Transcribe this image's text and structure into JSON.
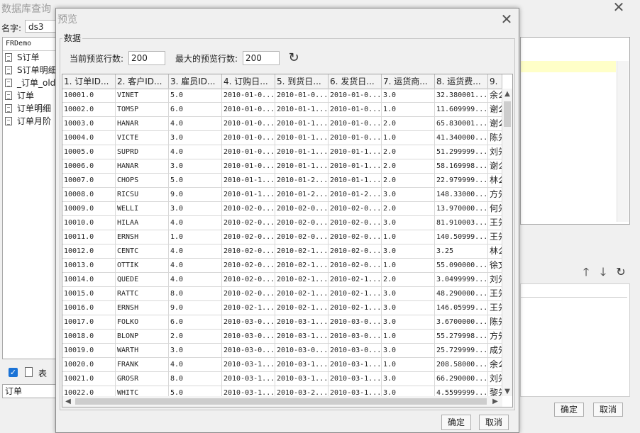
{
  "background_window": {
    "title": "数据库查询",
    "name_label": "名字:",
    "name_value": "ds3",
    "connection": "FRDemo",
    "tree_items": [
      "S订单",
      "S订单明细",
      "_订单_old",
      "订单",
      "订单明细",
      "订单月阶"
    ],
    "show_table_label": "表",
    "bottom_value": "订单",
    "ok_label": "确定",
    "cancel_label": "取消"
  },
  "dialog": {
    "title": "预览",
    "group_label": "数据",
    "current_rows_label": "当前预览行数:",
    "current_rows_value": "200",
    "max_rows_label": "最大的预览行数:",
    "max_rows_value": "200",
    "ok_label": "确定",
    "cancel_label": "取消"
  },
  "grid": {
    "columns": [
      "1. 订单ID...",
      "2. 客户ID...",
      "3. 雇员ID...",
      "4. 订购日...",
      "5. 到货日...",
      "6. 发货日...",
      "7. 运货商...",
      "8. 运货费...",
      "9."
    ],
    "rows": [
      [
        "10001.0",
        "VINET",
        "5.0",
        "2010-01-0...",
        "2010-01-0...",
        "2010-01-0...",
        "3.0",
        "32.380001...",
        "余么"
      ],
      [
        "10002.0",
        "TOMSP",
        "6.0",
        "2010-01-0...",
        "2010-01-1...",
        "2010-01-0...",
        "1.0",
        "11.609999...",
        "谢么"
      ],
      [
        "10003.0",
        "HANAR",
        "4.0",
        "2010-01-0...",
        "2010-01-1...",
        "2010-01-0...",
        "2.0",
        "65.830001...",
        "谢么"
      ],
      [
        "10004.0",
        "VICTE",
        "3.0",
        "2010-01-0...",
        "2010-01-1...",
        "2010-01-0...",
        "1.0",
        "41.340000...",
        "陈先"
      ],
      [
        "10005.0",
        "SUPRD",
        "4.0",
        "2010-01-0...",
        "2010-01-1...",
        "2010-01-1...",
        "2.0",
        "51.299999...",
        "刘先"
      ],
      [
        "10006.0",
        "HANAR",
        "3.0",
        "2010-01-0...",
        "2010-01-1...",
        "2010-01-1...",
        "2.0",
        "58.169998...",
        "谢么"
      ],
      [
        "10007.0",
        "CHOPS",
        "5.0",
        "2010-01-1...",
        "2010-01-2...",
        "2010-01-1...",
        "2.0",
        "22.979999...",
        "林么"
      ],
      [
        "10008.0",
        "RICSU",
        "9.0",
        "2010-01-1...",
        "2010-01-2...",
        "2010-01-2...",
        "3.0",
        "148.33000...",
        "方先"
      ],
      [
        "10009.0",
        "WELLI",
        "3.0",
        "2010-02-0...",
        "2010-02-0...",
        "2010-02-0...",
        "2.0",
        "13.970000...",
        "何先"
      ],
      [
        "10010.0",
        "HILAA",
        "4.0",
        "2010-02-0...",
        "2010-02-0...",
        "2010-02-0...",
        "3.0",
        "81.910003...",
        "王先"
      ],
      [
        "10011.0",
        "ERNSH",
        "1.0",
        "2010-02-0...",
        "2010-02-0...",
        "2010-02-0...",
        "1.0",
        "140.50999...",
        "王先"
      ],
      [
        "10012.0",
        "CENTC",
        "4.0",
        "2010-02-0...",
        "2010-02-1...",
        "2010-02-0...",
        "3.0",
        "3.25",
        "林么"
      ],
      [
        "10013.0",
        "OTTIK",
        "4.0",
        "2010-02-0...",
        "2010-02-1...",
        "2010-02-0...",
        "1.0",
        "55.090000...",
        "徐文"
      ],
      [
        "10014.0",
        "QUEDE",
        "4.0",
        "2010-02-0...",
        "2010-02-1...",
        "2010-02-1...",
        "2.0",
        "3.0499999...",
        "刘先"
      ],
      [
        "10015.0",
        "RATTC",
        "8.0",
        "2010-02-0...",
        "2010-02-1...",
        "2010-02-1...",
        "3.0",
        "48.290000...",
        "王先"
      ],
      [
        "10016.0",
        "ERNSH",
        "9.0",
        "2010-02-1...",
        "2010-02-1...",
        "2010-02-1...",
        "3.0",
        "146.05999...",
        "王先"
      ],
      [
        "10017.0",
        "FOLKO",
        "6.0",
        "2010-03-0...",
        "2010-03-1...",
        "2010-03-0...",
        "3.0",
        "3.6700000...",
        "陈先"
      ],
      [
        "10018.0",
        "BLONP",
        "2.0",
        "2010-03-0...",
        "2010-03-1...",
        "2010-03-0...",
        "1.0",
        "55.279998...",
        "方先"
      ],
      [
        "10019.0",
        "WARTH",
        "3.0",
        "2010-03-0...",
        "2010-03-0...",
        "2010-03-0...",
        "3.0",
        "25.729999...",
        "成先"
      ],
      [
        "10020.0",
        "FRANK",
        "4.0",
        "2010-03-1...",
        "2010-03-1...",
        "2010-03-1...",
        "1.0",
        "208.58000...",
        "余么"
      ],
      [
        "10021.0",
        "GROSR",
        "8.0",
        "2010-03-1...",
        "2010-03-1...",
        "2010-03-1...",
        "3.0",
        "66.290000...",
        "刘先"
      ],
      [
        "10022.0",
        "WHITC",
        "5.0",
        "2010-03-1...",
        "2010-03-2...",
        "2010-03-1...",
        "3.0",
        "4.5599999...",
        "黎先"
      ]
    ]
  },
  "icons": {
    "refresh": "refresh-icon",
    "close": "close-icon",
    "up": "arrow-up-icon",
    "down": "arrow-down-icon"
  }
}
